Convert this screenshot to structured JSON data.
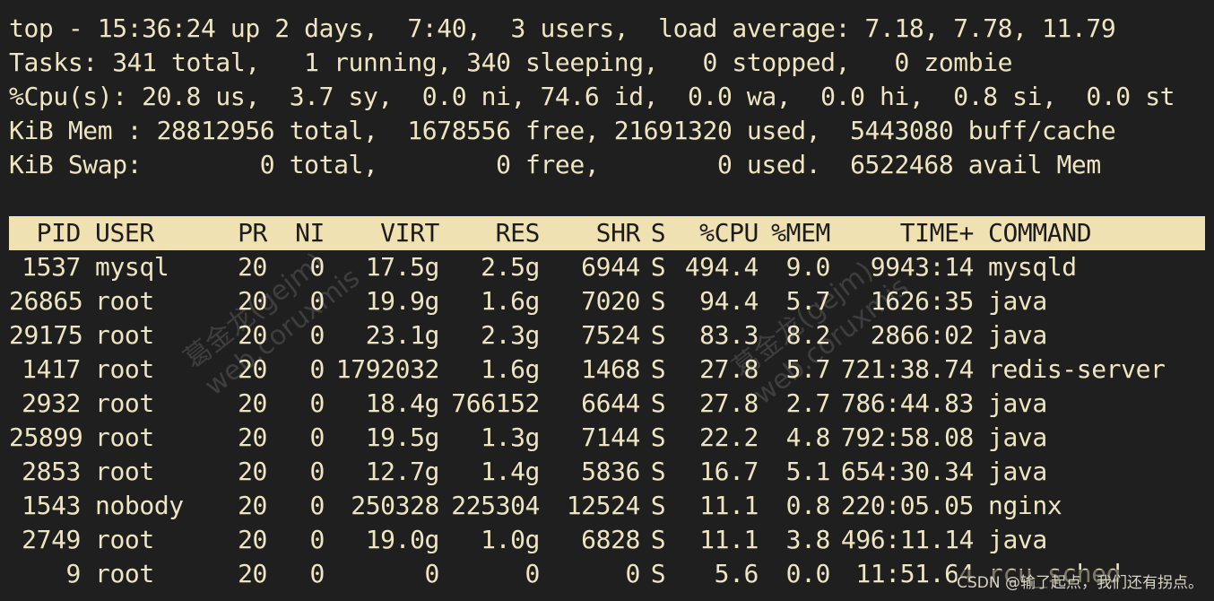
{
  "summary": {
    "top_line": "top - 15:36:24 up 2 days,  7:40,  3 users,  load average: 7.18, 7.78, 11.79",
    "tasks_line": "Tasks: 341 total,   1 running, 340 sleeping,   0 stopped,   0 zombie",
    "cpu_line": "%Cpu(s): 20.8 us,  3.7 sy,  0.0 ni, 74.6 id,  0.0 wa,  0.0 hi,  0.8 si,  0.0 st",
    "mem_line": "KiB Mem : 28812956 total,  1678556 free, 21691320 used,  5443080 buff/cache",
    "swap_line": "KiB Swap:        0 total,        0 free,        0 used.  6522468 avail Mem"
  },
  "table": {
    "headers": {
      "pid": "PID",
      "user": "USER",
      "pr": "PR",
      "ni": "NI",
      "virt": "VIRT",
      "res": "RES",
      "shr": "SHR",
      "s": "S",
      "cpu": "%CPU",
      "mem": "%MEM",
      "time": "TIME+",
      "command": "COMMAND"
    },
    "rows": [
      {
        "pid": "1537",
        "user": "mysql",
        "pr": "20",
        "ni": "0",
        "virt": "17.5g",
        "res": "2.5g",
        "shr": "6944",
        "s": "S",
        "cpu": "494.4",
        "mem": "9.0",
        "time": "9943:14",
        "command": "mysqld"
      },
      {
        "pid": "26865",
        "user": "root",
        "pr": "20",
        "ni": "0",
        "virt": "19.9g",
        "res": "1.6g",
        "shr": "7020",
        "s": "S",
        "cpu": "94.4",
        "mem": "5.7",
        "time": "1626:35",
        "command": "java"
      },
      {
        "pid": "29175",
        "user": "root",
        "pr": "20",
        "ni": "0",
        "virt": "23.1g",
        "res": "2.3g",
        "shr": "7524",
        "s": "S",
        "cpu": "83.3",
        "mem": "8.2",
        "time": "2866:02",
        "command": "java"
      },
      {
        "pid": "1417",
        "user": "root",
        "pr": "20",
        "ni": "0",
        "virt": "1792032",
        "res": "1.6g",
        "shr": "1468",
        "s": "S",
        "cpu": "27.8",
        "mem": "5.7",
        "time": "721:38.74",
        "command": "redis-server"
      },
      {
        "pid": "2932",
        "user": "root",
        "pr": "20",
        "ni": "0",
        "virt": "18.4g",
        "res": "766152",
        "shr": "6644",
        "s": "S",
        "cpu": "27.8",
        "mem": "2.7",
        "time": "786:44.83",
        "command": "java"
      },
      {
        "pid": "25899",
        "user": "root",
        "pr": "20",
        "ni": "0",
        "virt": "19.5g",
        "res": "1.3g",
        "shr": "7144",
        "s": "S",
        "cpu": "22.2",
        "mem": "4.8",
        "time": "792:58.08",
        "command": "java"
      },
      {
        "pid": "2853",
        "user": "root",
        "pr": "20",
        "ni": "0",
        "virt": "12.7g",
        "res": "1.4g",
        "shr": "5836",
        "s": "S",
        "cpu": "16.7",
        "mem": "5.1",
        "time": "654:30.34",
        "command": "java"
      },
      {
        "pid": "1543",
        "user": "nobody",
        "pr": "20",
        "ni": "0",
        "virt": "250328",
        "res": "225304",
        "shr": "12524",
        "s": "S",
        "cpu": "11.1",
        "mem": "0.8",
        "time": "220:05.05",
        "command": "nginx"
      },
      {
        "pid": "2749",
        "user": "root",
        "pr": "20",
        "ni": "0",
        "virt": "19.0g",
        "res": "1.0g",
        "shr": "6828",
        "s": "S",
        "cpu": "11.1",
        "mem": "3.8",
        "time": "496:11.14",
        "command": "java"
      },
      {
        "pid": "9",
        "user": "root",
        "pr": "20",
        "ni": "0",
        "virt": "0",
        "res": "0",
        "shr": "0",
        "s": "S",
        "cpu": "5.6",
        "mem": "0.0",
        "time": "11:51.64",
        "command": "rcu_sched"
      }
    ]
  },
  "watermark": {
    "text": "葛金龙(gejm)\nweb.coruxmis"
  },
  "footer": {
    "credit": "CSDN @输了起点，我们还有拐点。"
  }
}
